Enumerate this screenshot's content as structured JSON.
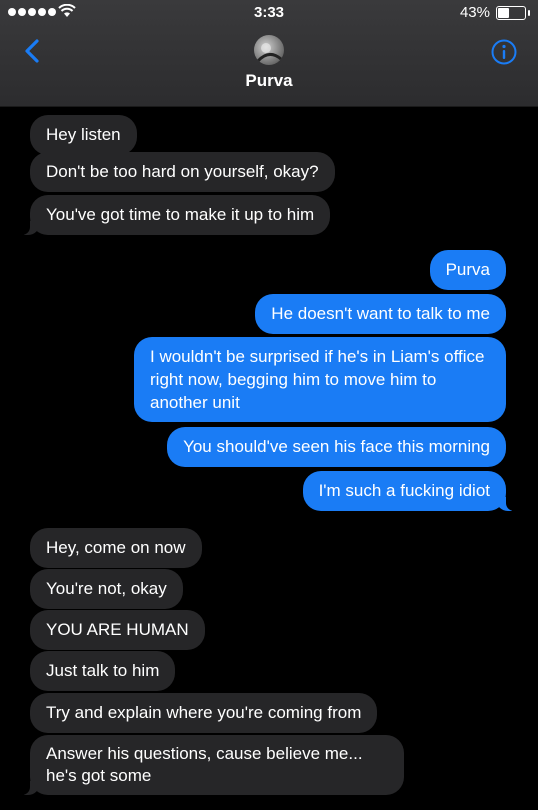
{
  "status": {
    "time": "3:33",
    "battery_percent": "43%",
    "battery_level": 0.43
  },
  "header": {
    "contact_name": "Purva"
  },
  "messages": [
    {
      "from": "them",
      "text": "Hey listen"
    },
    {
      "from": "them",
      "text": "Don't be too hard on yourself, okay?"
    },
    {
      "from": "them",
      "text": "You've got time to make it up to him"
    },
    {
      "from": "me",
      "text": "Purva"
    },
    {
      "from": "me",
      "text": "He doesn't want to talk to me"
    },
    {
      "from": "me",
      "text": "I wouldn't be surprised if he's in Liam's office right now, begging him to move him to another unit"
    },
    {
      "from": "me",
      "text": "You should've seen his face this morning"
    },
    {
      "from": "me",
      "text": "I'm such a fucking idiot"
    },
    {
      "from": "them",
      "text": "Hey, come on now"
    },
    {
      "from": "them",
      "text": "You're not, okay"
    },
    {
      "from": "them",
      "text": "YOU ARE HUMAN"
    },
    {
      "from": "them",
      "text": "Just talk to him"
    },
    {
      "from": "them",
      "text": "Try and explain where you're coming from"
    },
    {
      "from": "them",
      "text": "Answer his questions, cause believe me... he's got some"
    }
  ],
  "colors": {
    "incoming_bubble": "#262628",
    "outgoing_bubble": "#1a7cf5",
    "accent": "#1a7cf5"
  }
}
